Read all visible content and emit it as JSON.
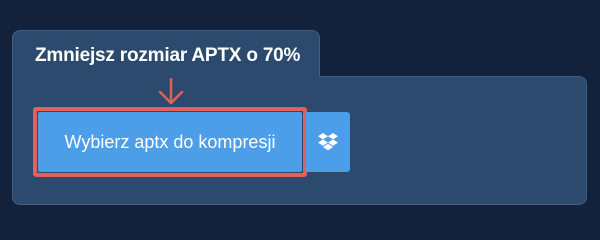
{
  "panel": {
    "title": "Zmniejsz rozmiar APTX o 70%"
  },
  "upload": {
    "choose_button_label": "Wybierz aptx do kompresji",
    "secondary_button_icon": "dropbox-icon"
  },
  "colors": {
    "page_background": "#13223a",
    "panel_background": "#2c4a6d",
    "button_background": "#4d9ee8",
    "highlight": "#e0605a"
  }
}
